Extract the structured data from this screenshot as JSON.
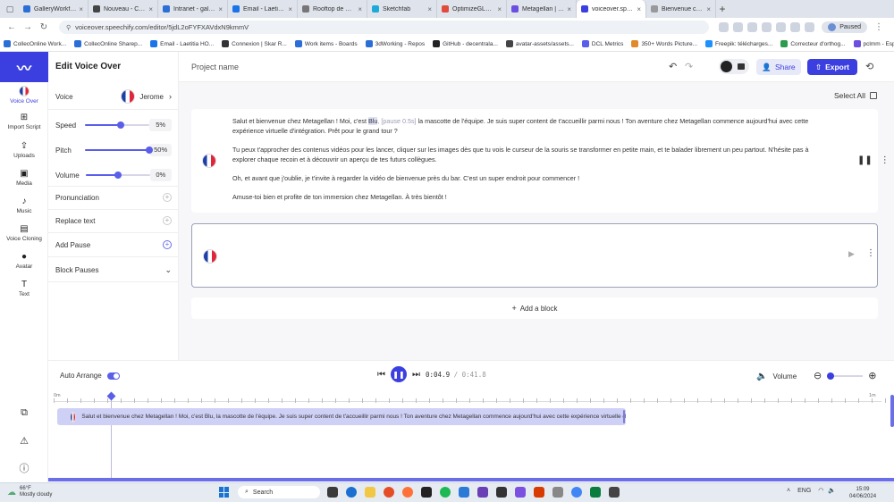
{
  "browser": {
    "tabs": [
      {
        "title": "GalleryWorkflow.ui...",
        "color": "#2b6fd6"
      },
      {
        "title": "Nouveau - Comm...",
        "color": "#444"
      },
      {
        "title": "Intranet - gallerie...",
        "color": "#2b6fd6"
      },
      {
        "title": "Email - Laetitia HO...",
        "color": "#1a73e8"
      },
      {
        "title": "Rooftop de Metage...",
        "color": "#777"
      },
      {
        "title": "Sketchfab",
        "color": "#1caad9"
      },
      {
        "title": "OptimizeGLB - Con...",
        "color": "#e24a3b"
      },
      {
        "title": "Metagellan | Créa...",
        "color": "#6b4fe0"
      },
      {
        "title": "voiceover.spee...",
        "color": "#3b3fe0"
      },
      {
        "title": "Bienvenue chez M...",
        "color": "#999"
      }
    ],
    "active_tab": 8,
    "url": "voiceover.speechify.com/editor/5jdL2oFYFXAVdxN9kmmV",
    "profile_label": "Paused",
    "bookmarks": [
      "CollecOnline Work...",
      "CollecOnline Sharep...",
      "Email - Laetitia HO...",
      "Connexion | Skar R...",
      "Work items - Boards",
      "3dWorking - Repos",
      "GitHub - decentrala...",
      "avatar-assets/assets...",
      "DCL Metrics",
      "350+ Words Picture...",
      "Freepik: télécharges...",
      "Correcteur d'orthog...",
      "pclmm - Espace sola..."
    ]
  },
  "rail": {
    "items": [
      {
        "label": "Voice Over",
        "icon": "flag-icon"
      },
      {
        "label": "Import Script",
        "icon": "import-icon"
      },
      {
        "label": "Uploads",
        "icon": "upload-icon"
      },
      {
        "label": "Media",
        "icon": "media-icon"
      },
      {
        "label": "Music",
        "icon": "music-icon"
      },
      {
        "label": "Voice Cloning",
        "icon": "voice-cloning-icon"
      },
      {
        "label": "Avatar",
        "icon": "avatar-icon"
      },
      {
        "label": "Text",
        "icon": "text-icon"
      }
    ]
  },
  "panel": {
    "title": "Edit Voice Over",
    "voice_label": "Voice",
    "voice_value": "Jerome",
    "speed_label": "Speed",
    "speed_value": "5%",
    "speed_level": 0.55,
    "pitch_label": "Pitch",
    "pitch_value": "50%",
    "pitch_level": 1.0,
    "volume_label": "Volume",
    "volume_value": "0%",
    "volume_level": 0.5,
    "pronunciation_label": "Pronunciation",
    "replace_label": "Replace text",
    "addpause_label": "Add Pause",
    "blockpauses_label": "Block Pauses"
  },
  "topbar": {
    "project_name": "Project name",
    "share_label": "Share",
    "export_label": "Export"
  },
  "editor": {
    "select_all_label": "Select All",
    "block1": {
      "p1_pre": "Salut et bienvenue chez Metagellan ! Moi, c'est ",
      "p1_name": "Blu",
      "p1_pause": ", [pause 0.5s]",
      "p1_post": " la mascotte de l'équipe. Je suis super content de t'accueillir parmi nous ! Ton aventure chez Metagellan commence aujourd'hui avec cette expérience virtuelle d'intégration. Prêt pour le grand tour ?",
      "p2": "Tu peux t'approcher des contenus vidéos pour les lancer, cliquer sur les images dès que tu vois le curseur de la souris se transformer en petite main, et te balader librement un peu partout. N'hésite pas à explorer chaque recoin et à découvrir un aperçu de tes futurs collègues.",
      "p3": "Oh, et avant que j'oublie, je t'invite à regarder la vidéo de bienvenue près du bar. C'est un super endroit pour commencer !",
      "p4": "Amuse-toi bien et profite de ton immersion chez Metagellan. À très bientôt !"
    },
    "add_block_label": "Add a block"
  },
  "timeline": {
    "auto_arrange_label": "Auto Arrange",
    "current_time": "0:04.9",
    "separator": "/",
    "total_time": "0:41.8",
    "volume_label": "Volume",
    "ruler_start": "0m",
    "ruler_end": "1m",
    "clip_text": "Salut et bienvenue chez Metagellan ! Moi, c'est Blu, la mascotte de l'équipe. Je suis super content de t'accueillir parmi nous ! Ton aventure chez Metagellan commence aujourd'hui avec cette expérience virtuelle d"
  },
  "taskbar": {
    "temp": "66°F",
    "weather": "Mostly cloudy",
    "search_label": "Search",
    "lang": "ENG",
    "time": "15:09",
    "date": "04/06/2024"
  }
}
